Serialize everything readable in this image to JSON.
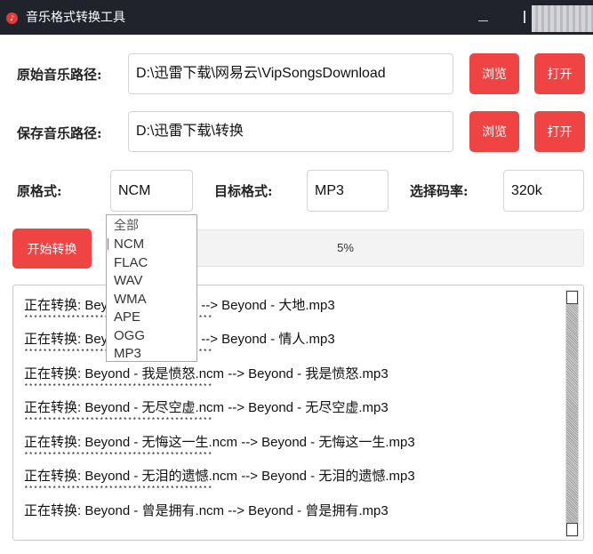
{
  "window": {
    "title": "音乐格式转换工具",
    "icon": "music-note-icon",
    "accent_color": "#f04343",
    "titlebar_color": "#20222c"
  },
  "source": {
    "label": "原始音乐路径:",
    "value": "D:\\迅雷下载\\网易云\\VipSongsDownload",
    "browse_label": "浏览",
    "open_label": "打开"
  },
  "save": {
    "label": "保存音乐路径:",
    "value": "D:\\迅雷下载\\转换",
    "browse_label": "浏览",
    "open_label": "打开"
  },
  "format": {
    "source_label": "原格式:",
    "source_value": "NCM",
    "target_label": "目标格式:",
    "target_value": "MP3",
    "bitrate_label": "选择码率:",
    "bitrate_value": "320k"
  },
  "dropdown": {
    "options": [
      "全部",
      "NCM",
      "FLAC",
      "WAV",
      "WMA",
      "APE",
      "OGG",
      "MP3"
    ],
    "selected": "NCM"
  },
  "convert": {
    "button_label": "开始转换",
    "progress_text": "5%",
    "progress": 0.05
  },
  "log": {
    "separator": "****************************************",
    "lines": [
      "正在转换: Beyond - 大地.ncm --> Beyond - 大地.mp3",
      "正在转换: Beyond - 情人.ncm --> Beyond - 情人.mp3",
      "正在转换: Beyond - 我是愤怒.ncm --> Beyond - 我是愤怒.mp3",
      "正在转换: Beyond - 无尽空虚.ncm --> Beyond - 无尽空虚.mp3",
      "正在转换: Beyond - 无悔这一生.ncm --> Beyond - 无悔这一生.mp3",
      "正在转换: Beyond - 无泪的遗憾.ncm --> Beyond - 无泪的遗憾.mp3",
      "正在转换: Beyond - 曾是拥有.ncm --> Beyond - 曾是拥有.mp3"
    ]
  }
}
